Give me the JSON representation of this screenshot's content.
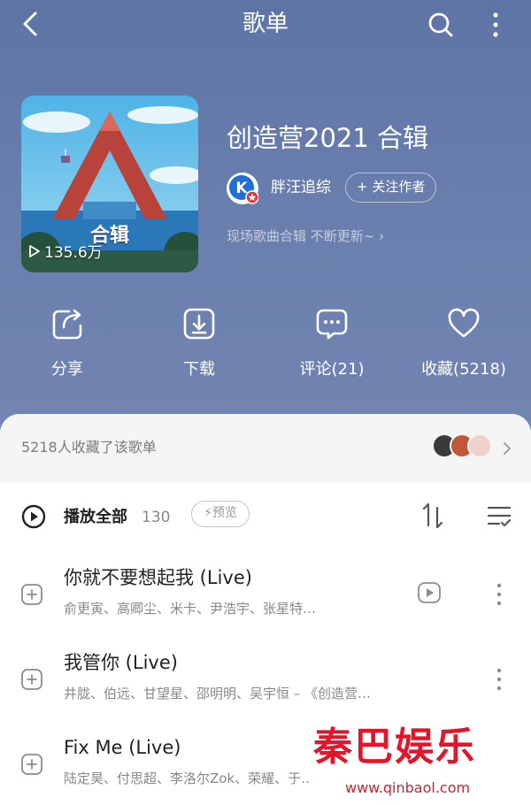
{
  "header": {
    "title": "歌单"
  },
  "playlist": {
    "title": "创造营2021 合辑",
    "play_count": "135.6万",
    "cover_text": "合辑",
    "creator_name": "胖汪追综",
    "creator_badge": "K",
    "follow_label": "+ 关注作者",
    "description": "现场歌曲合辑 不断更新~ ›"
  },
  "actions": {
    "share_label": "分享",
    "download_label": "下载",
    "comment_label": "评论(21)",
    "favorite_label": "收藏(5218)"
  },
  "collect_bar": {
    "text": "5218人收藏了该歌单"
  },
  "list_header": {
    "play_all_label": "播放全部",
    "count": "130",
    "preview_label": "⚡预览"
  },
  "songs": [
    {
      "title": "你就不要想起我 (Live)",
      "artists": "俞更寅、高卿尘、米卡、尹浩宇、张星特…",
      "has_mv": true
    },
    {
      "title": "我管你 (Live)",
      "artists": "井胧、伯远、甘望星、邵明明、吴宇恒 – 《创造营…",
      "has_mv": false
    },
    {
      "title": "Fix Me (Live)",
      "artists": "陆定昊、付思超、李洛尔Zok、荣耀、于…",
      "has_mv": false
    }
  ],
  "watermark": {
    "logo": "秦巴娱乐",
    "url": "www.qinbaol.com"
  },
  "colors": {
    "hero_bg": "#6176a3",
    "badge_red": "#e8323c",
    "creator_blue": "#1f6fd6",
    "watermark_red": "#e4152a"
  }
}
